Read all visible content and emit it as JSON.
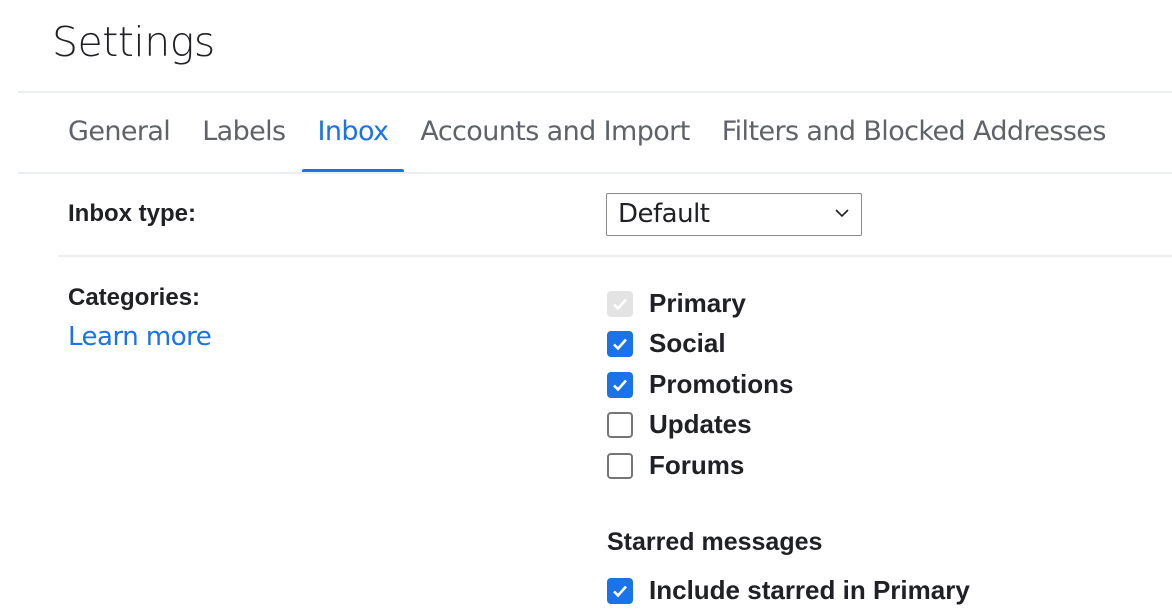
{
  "page_title": "Settings",
  "tabs": [
    {
      "label": "General"
    },
    {
      "label": "Labels"
    },
    {
      "label": "Inbox",
      "active": true
    },
    {
      "label": "Accounts and Import"
    },
    {
      "label": "Filters and Blocked Addresses"
    }
  ],
  "inbox_type": {
    "label": "Inbox type:",
    "value": "Default"
  },
  "categories": {
    "label": "Categories:",
    "learn_more": "Learn more",
    "items": [
      {
        "label": "Primary",
        "checked": true,
        "disabled": true
      },
      {
        "label": "Social",
        "checked": true
      },
      {
        "label": "Promotions",
        "checked": true
      },
      {
        "label": "Updates",
        "checked": false
      },
      {
        "label": "Forums",
        "checked": false
      }
    ]
  },
  "starred": {
    "heading": "Starred messages",
    "option": "Include starred in Primary",
    "checked": true
  },
  "colors": {
    "accent": "#1a73e8"
  }
}
